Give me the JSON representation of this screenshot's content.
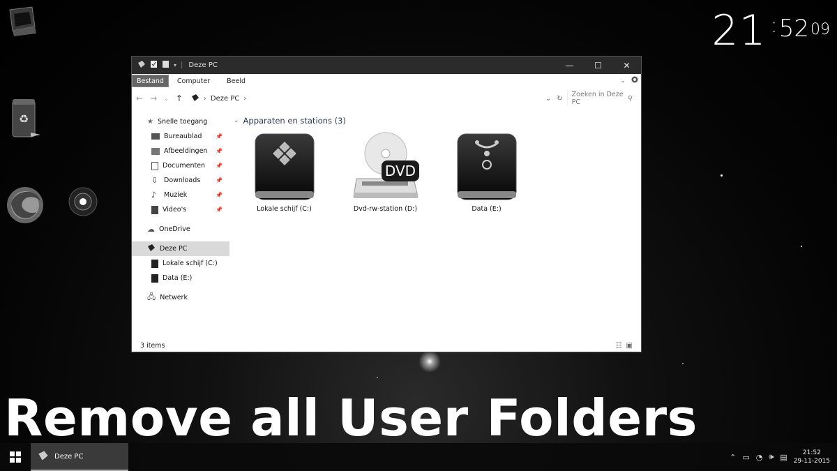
{
  "clock": {
    "hours": "21",
    "minutes": "52",
    "seconds": "09"
  },
  "window": {
    "title": "Deze PC",
    "ribbon_tabs": [
      "Bestand",
      "Computer",
      "Beeld"
    ],
    "address": {
      "root": "Deze PC"
    },
    "search_placeholder": "Zoeken in Deze PC",
    "nav": {
      "quick_access": "Snelle toegang",
      "quick_items": [
        "Bureaublad",
        "Afbeeldingen",
        "Documenten",
        "Downloads",
        "Muziek",
        "Video's"
      ],
      "onedrive": "OneDrive",
      "this_pc": "Deze PC",
      "pc_items": [
        "Lokale schijf (C:)",
        "Data (E:)"
      ],
      "network": "Netwerk"
    },
    "group_header": "Apparaten en stations (3)",
    "drives": [
      {
        "name": "Lokale schijf (C:)",
        "icon": "windows-drive-icon"
      },
      {
        "name": "Dvd-rw-station (D:)",
        "icon": "dvd-drive-icon",
        "badge": "DVD"
      },
      {
        "name": "Data (E:)",
        "icon": "firewire-drive-icon"
      }
    ],
    "status": "3 items"
  },
  "banner": "Remove all User Folders",
  "taskbar": {
    "task_label": "Deze PC",
    "time": "21:52",
    "date": "29-11-2015"
  }
}
